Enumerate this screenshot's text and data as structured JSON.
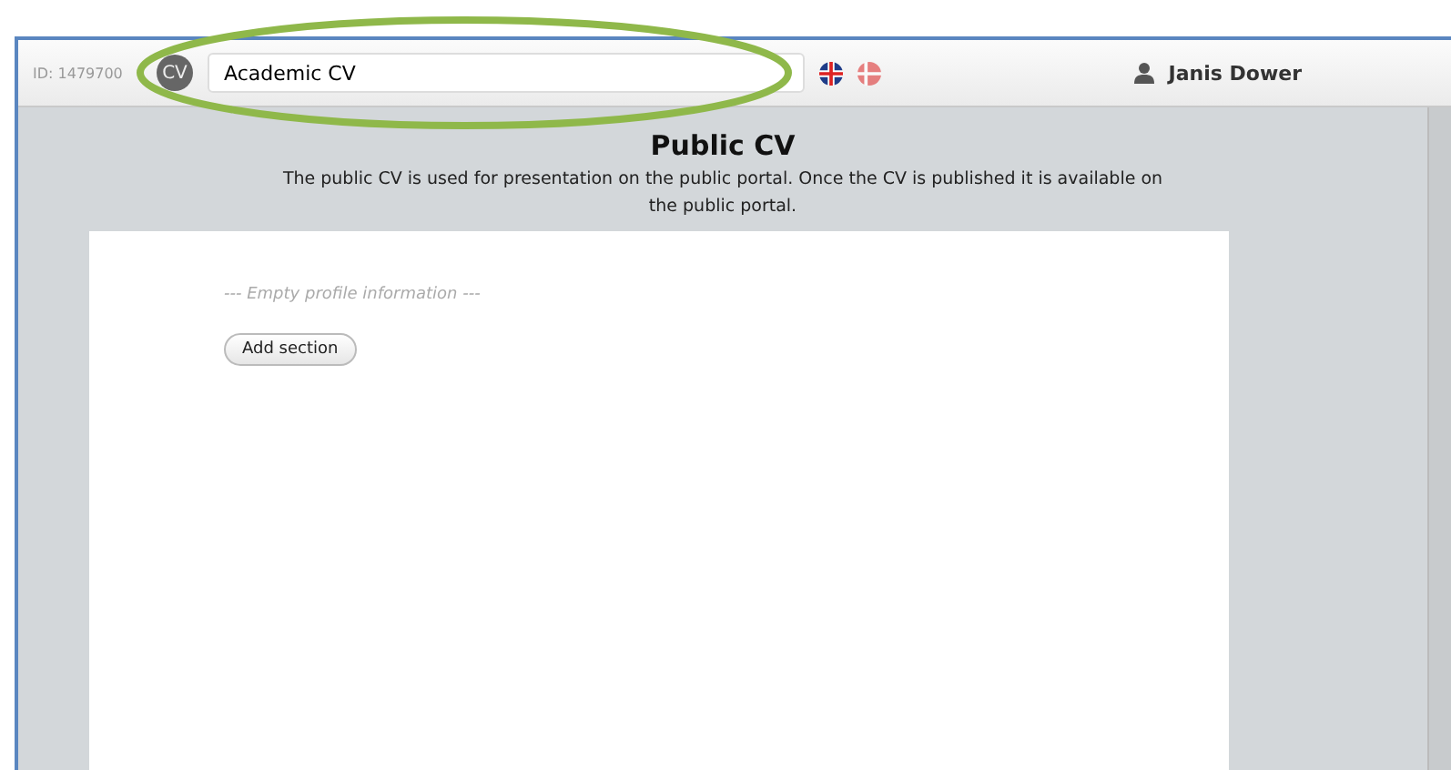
{
  "topbar": {
    "id_label": "ID: 1479700",
    "logo": "CV",
    "cv_name": "Academic CV",
    "user": "Janis Dower"
  },
  "languages": [
    {
      "kind": "uk",
      "selected": true
    },
    {
      "kind": "dk",
      "selected": false
    }
  ],
  "header": {
    "title": "Public CV",
    "description": "The public CV is used for presentation on the public portal. Once the CV is published it is available on the public portal."
  },
  "content": {
    "empty_note": "--- Empty profile information ---",
    "button": "Add section"
  }
}
